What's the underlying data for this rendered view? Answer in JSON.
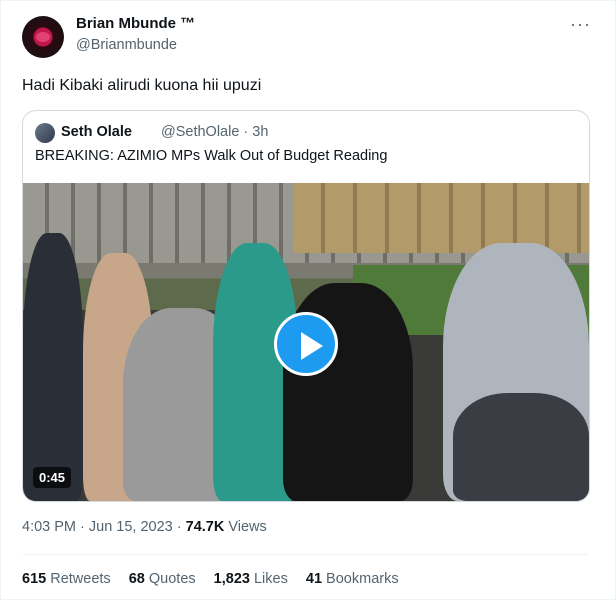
{
  "author": {
    "name": "Brian Mbunde ™",
    "handle": "@Brianmbunde"
  },
  "menu_icon": "more-horizontal-icon",
  "tweet": {
    "text": "Hadi Kibaki alirudi kuona hii upuzi"
  },
  "quote": {
    "name": "Seth Olale",
    "handle": "@SethOlale · 3h",
    "text": "BREAKING: AZIMIO MPs Walk Out of Budget Reading",
    "video": {
      "duration": "0:45",
      "play_icon": "play-icon"
    }
  },
  "meta": {
    "time": "4:03 PM · Jun 15, 2023 · ",
    "views_count": "74.7K",
    "views_label": " Views"
  },
  "stats": [
    {
      "count": "615",
      "label": " Retweets"
    },
    {
      "count": "68",
      "label": " Quotes"
    },
    {
      "count": "1,823",
      "label": " Likes"
    },
    {
      "count": "41",
      "label": " Bookmarks"
    }
  ],
  "colors": {
    "accent": "#1d9bf0",
    "secondary_text": "#536471",
    "border": "#cfd9de"
  }
}
